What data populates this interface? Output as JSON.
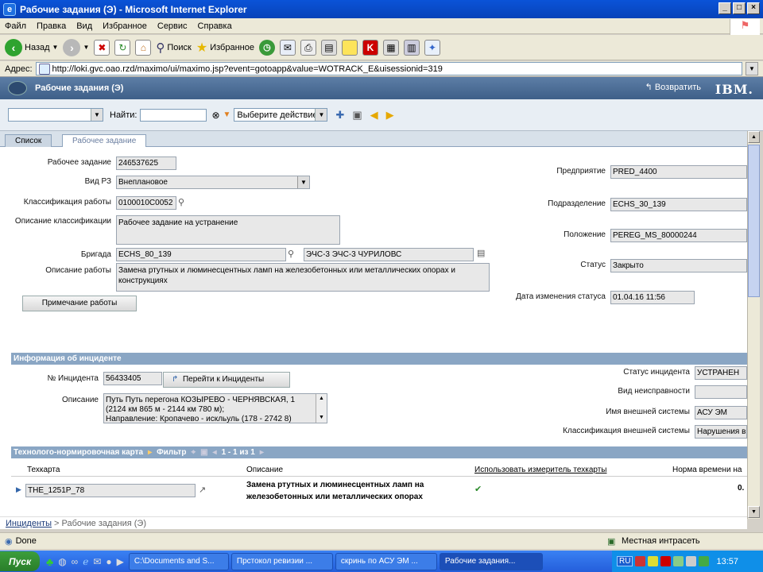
{
  "window": {
    "title": "Рабочие задания (Э) - Microsoft Internet Explorer"
  },
  "menu": [
    "Файл",
    "Правка",
    "Вид",
    "Избранное",
    "Сервис",
    "Справка"
  ],
  "toolbar": {
    "back": "Назад",
    "search": "Поиск",
    "favorites": "Избранное"
  },
  "address": {
    "label": "Адрес:",
    "url": "http://loki.gvc.oao.rzd/maximo/ui/maximo.jsp?event=gotoapp&value=WOTRACK_E&uisessionid=319"
  },
  "app": {
    "title": "Рабочие задания (Э)",
    "return_label": "Возвратить",
    "logo": "IBM."
  },
  "actionbar": {
    "find_label": "Найти:",
    "action_select": "Выберите действие"
  },
  "tabs": [
    "Список",
    "Рабочее задание"
  ],
  "fields": {
    "wo_label": "Рабочее задание",
    "wo_value": "246537625",
    "type_label": "Вид РЗ",
    "type_value": "Внеплановое",
    "class_label": "Классификация работы",
    "class_value": "0100010С0052",
    "classdesc_label": "Описание классификации",
    "classdesc_value": "Рабочее задание на устранение",
    "crew_label": "Бригада",
    "crew_value": "ECHS_80_139",
    "crew_desc": "ЭЧС-3 ЭЧС-3 ЧУРИЛОВС",
    "desc_label": "Описание работы",
    "desc_value": "Замена ртутных и люминесцентных ламп на железобетонных или металлических опорах и конструкциях",
    "note_button": "Примечание работы",
    "org_label": "Предприятие",
    "org_value": "PRED_4400",
    "dept_label": "Подразделение",
    "dept_value": "ECHS_30_139",
    "loc_label": "Положение",
    "loc_value": "PEREG_MS_80000244",
    "status_label": "Статус",
    "status_value": "Закрыто",
    "statusdate_label": "Дата изменения статуса",
    "statusdate_value": "01.04.16 11:56"
  },
  "incident": {
    "section_title": "Информация об инциденте",
    "num_label": "№ Инцидента",
    "num_value": "56433405",
    "goto_button": "Перейти к Инциденты",
    "desc_label": "Описание",
    "desc_lines": [
      "Путь Путь перегона КОЗЫРЕВО - ЧЕРНЯВСКАЯ, 1",
      "(2124 км 865 м - 2144 км 780 м);",
      "Направление: Кропачево - искльуль (178 - 2742 8)"
    ],
    "status_label": "Статус инцидента",
    "status_value": "УСТРАНЕН",
    "fault_label": "Вид неисправности",
    "fault_value": "",
    "extsys_label": "Имя внешней системы",
    "extsys_value": "АСУ ЭМ",
    "extclass_label": "Классификация внешней системы",
    "extclass_value": "Нарушения в"
  },
  "techcard": {
    "section_title": "Технолого-нормировочная карта",
    "filter_label": "Фильтр",
    "paging": "1 - 1 из 1",
    "col_card": "Техкарта",
    "col_desc": "Описание",
    "col_use": "Использовать измеритель техкарты",
    "col_norm": "Норма времени на",
    "row_card": "ТНЕ_1251Р_78",
    "row_desc": "Замена ртутных и люминесцентных ламп на железобетонных или металлических опорах",
    "row_norm": "0."
  },
  "breadcrumb": {
    "link": "Инциденты",
    "current": "> Рабочие задания (Э)"
  },
  "statusbar": {
    "left": "Done",
    "zone": "Местная интрасеть"
  },
  "taskbar": {
    "start": "Пуск",
    "tasks": [
      "C:\\Documents and S...",
      "Прстокол ревизии ...",
      "скринь по АСУ ЭМ ...",
      "Рабочие задания..."
    ],
    "lang": "RU",
    "clock": "13:57"
  }
}
